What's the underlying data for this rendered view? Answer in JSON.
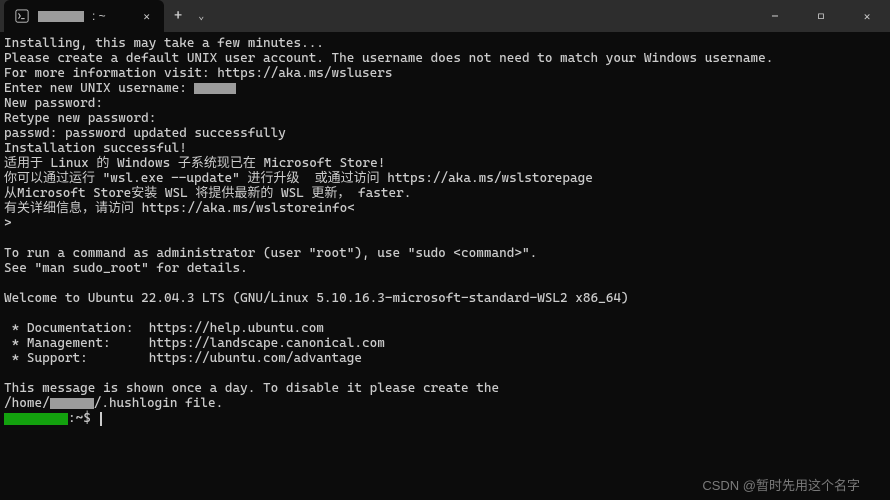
{
  "titlebar": {
    "tab_title": ": ~",
    "close_label": "✕",
    "newtab_label": "+",
    "dropdown_label": "⌄",
    "minimize_label": "—",
    "maximize_label": "□",
    "wclose_label": "✕"
  },
  "terminal": {
    "lines": [
      "Installing, this may take a few minutes...",
      "Please create a default UNIX user account. The username does not need to match your Windows username.",
      "For more information visit: https://aka.ms/wslusers",
      "Enter new UNIX username: ",
      "New password:",
      "Retype new password:",
      "passwd: password updated successfully",
      "Installation successful!",
      "适用于 Linux 的 Windows 子系统现已在 Microsoft Store!",
      "你可以通过运行 \"wsl.exe --update\" 进行升级  或通过访问 https://aka.ms/wslstorepage",
      "从Microsoft Store安装 WSL 将提供最新的 WSL 更新， faster.",
      "有关详细信息，请访问 https://aka.ms/wslstoreinfo<",
      ">",
      "",
      "To run a command as administrator (user \"root\"), use \"sudo <command>\".",
      "See \"man sudo_root\" for details.",
      "",
      "Welcome to Ubuntu 22.04.3 LTS (GNU/Linux 5.10.16.3-microsoft-standard-WSL2 x86_64)",
      "",
      " * Documentation:  https://help.ubuntu.com",
      " * Management:     https://landscape.canonical.com",
      " * Support:        https://ubuntu.com/advantage",
      "",
      "This message is shown once a day. To disable it please create the",
      "/home/",
      "/.hushlogin file."
    ],
    "prompt_path": ":~$ "
  },
  "watermark": "CSDN @暂时先用这个名字"
}
